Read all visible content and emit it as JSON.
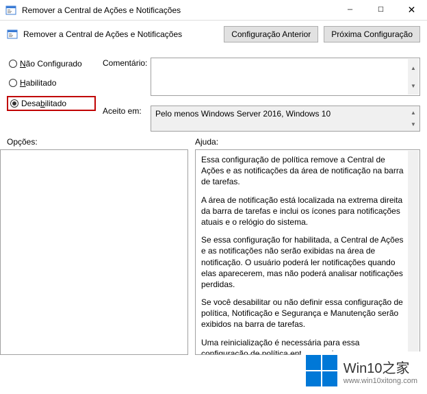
{
  "window": {
    "title": "Remover a Central de Ações e Notificações",
    "subtitle": "Remover a Central de Ações e Notificações"
  },
  "buttons": {
    "prev": "Configuração Anterior",
    "next": "Próxima Configuração"
  },
  "radios": {
    "not_configured": "ão Configurado",
    "not_configured_u": "N",
    "enabled": "abilitado",
    "enabled_u": "H",
    "disabled_pre": "Desa",
    "disabled_u": "b",
    "disabled_post": "ilitado"
  },
  "fields": {
    "comment_label": "Comentário:",
    "accept_label": "Aceito em:",
    "accept_value": "Pelo menos Windows Server 2016, Windows 10"
  },
  "lower": {
    "options_label": "Opções:",
    "help_label": "Ajuda:"
  },
  "help": {
    "p1": "Essa configuração de política remove a Central de Ações e as notificações da área de notificação na barra de tarefas.",
    "p2": "A área de notificação está localizada na extrema direita da barra de tarefas e inclui os ícones para notificações atuais e o relógio do sistema.",
    "p3": "Se essa configuração for habilitada, a Central de Ações e as notificações não serão exibidas na área de notificação. O usuário poderá ler notificações quando elas aparecerem, mas não poderá analisar notificações perdidas.",
    "p4": "Se você desabilitar ou não definir essa configuração de política, Notificação e Segurança e Manutenção serão exibidos na barra de tarefas.",
    "p5": "Uma reinicialização é necessária para essa configuração de política entrar em vigor."
  },
  "watermark": {
    "brand_en": "Win10",
    "brand_zh": "之家",
    "url": "www.win10xitong.com"
  }
}
